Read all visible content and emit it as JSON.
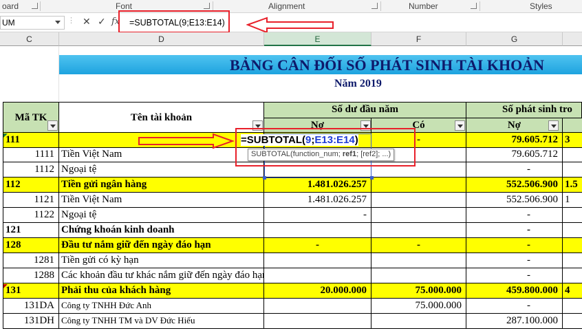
{
  "ribbon": {
    "groups": [
      {
        "label": "oard"
      },
      {
        "label": "Font"
      },
      {
        "label": "Alignment"
      },
      {
        "label": "Number"
      },
      {
        "label": "Styles"
      }
    ]
  },
  "formula_bar": {
    "name_box": "UM",
    "cancel_label": "✕",
    "enter_label": "✓",
    "fx_label": "fx",
    "formula": "=SUBTOTAL(9;E13:E14)"
  },
  "columns": [
    "C",
    "D",
    "E",
    "F",
    "G"
  ],
  "sheet": {
    "title": "BẢNG CÂN ĐỐI SỐ PHÁT SINH TÀI KHOẢN",
    "subtitle": "Năm 2019",
    "headers": {
      "ma_tk": "Mã TK",
      "ten_tk": "Tên tài khoản",
      "so_du_dau_nam": "Số dư đầu năm",
      "so_phat_sinh": "Số phát sinh tro",
      "no": "Nợ",
      "co": "Có",
      "no2": "Nợ"
    },
    "formula_in_cell": {
      "prefix": "=SUBTOTAL(",
      "num": "9",
      "sep": ";",
      "ref": "E13:E14",
      "suffix": ")"
    },
    "tooltip": {
      "fn": "SUBTOTAL(function_num;",
      "ref1": "ref1",
      "rest": "; [ref2]; ...)"
    },
    "rows": [
      {
        "code": "111",
        "name": "",
        "e": "",
        "f": "-",
        "g": "79.605.712",
        "h": "3"
      },
      {
        "code": "1111",
        "name": "Tiền Việt Nam",
        "e": "",
        "f": "",
        "g": "79.605.712",
        "h": ""
      },
      {
        "code": "1112",
        "name": "Ngoại tệ",
        "e": "",
        "f": "",
        "g": "-",
        "h": ""
      },
      {
        "code": "112",
        "name": "Tiền gửi ngân hàng",
        "e": "1.481.026.257",
        "f": "",
        "g": "552.506.900",
        "h": "1.5"
      },
      {
        "code": "1121",
        "name": "Tiền Việt Nam",
        "e": "1.481.026.257",
        "f": "",
        "g": "552.506.900",
        "h": "1"
      },
      {
        "code": "1122",
        "name": "Ngoại tệ",
        "e": "-",
        "f": "",
        "g": "-",
        "h": ""
      },
      {
        "code": "121",
        "name": "Chứng khoán kinh doanh",
        "e": "",
        "f": "",
        "g": "-",
        "h": ""
      },
      {
        "code": "128",
        "name": "Đầu tư nắm giữ đến ngày đáo hạn",
        "e": "-",
        "f": "-",
        "g": "-",
        "h": ""
      },
      {
        "code": "1281",
        "name": "Tiền gửi có kỳ hạn",
        "e": "",
        "f": "",
        "g": "-",
        "h": ""
      },
      {
        "code": "1288",
        "name": "Các khoản đầu tư khác nắm giữ đến ngày đáo hạn",
        "e": "",
        "f": "",
        "g": "-",
        "h": ""
      },
      {
        "code": "131",
        "name": "Phải thu của khách hàng",
        "e": "20.000.000",
        "f": "75.000.000",
        "g": "459.800.000",
        "h": "4"
      },
      {
        "code": "131DA",
        "name": "Công ty TNHH Đức Anh",
        "e": "",
        "f": "75.000.000",
        "g": "-",
        "h": ""
      },
      {
        "code": "131DH",
        "name": "Công ty TNHH TM và DV Đức Hiếu",
        "e": "",
        "f": "",
        "g": "287.100.000",
        "h": ""
      }
    ]
  }
}
